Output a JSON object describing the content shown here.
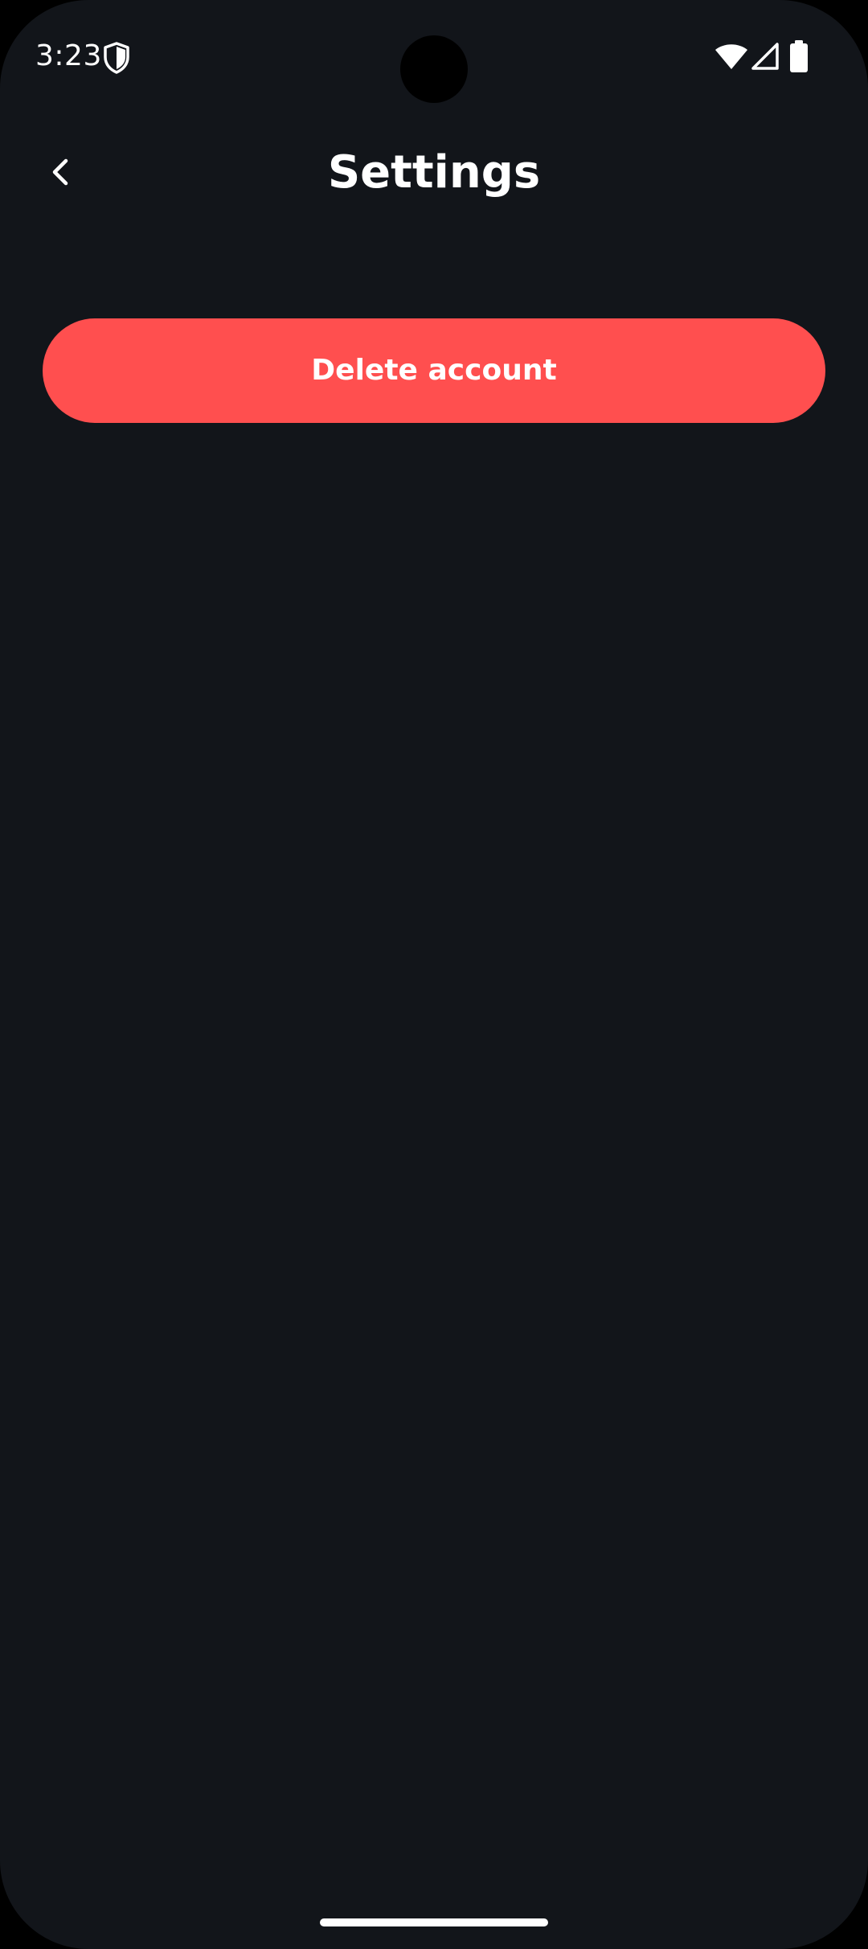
{
  "status_bar": {
    "time": "3:23",
    "icons": [
      "shield-icon",
      "wifi-icon",
      "signal-icon",
      "battery-icon"
    ]
  },
  "app_bar": {
    "title": "Settings",
    "back_icon": "chevron-left-icon"
  },
  "actions": {
    "delete_account_label": "Delete account"
  },
  "colors": {
    "background": "#12151a",
    "danger": "#ff4f4f",
    "text": "#ffffff"
  }
}
